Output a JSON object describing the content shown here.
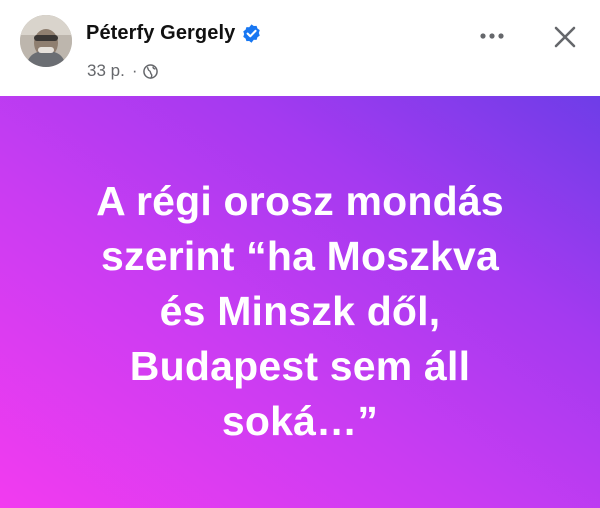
{
  "post": {
    "author": "Péterfy Gergely",
    "time": "33 p.",
    "separator": "·",
    "icons": {
      "verified": "verified-badge-icon",
      "audience": "globe-icon",
      "more": "more-options-icon",
      "close": "close-icon"
    },
    "colors": {
      "verified": "#1877f2",
      "banner_start": "#f23bf0",
      "banner_end": "#6e3de8"
    },
    "text_lines": [
      "A régi orosz mondás",
      "szerint “ha Moszkva",
      "és Minszk dől,",
      "Budapest sem áll",
      "soká…”"
    ]
  }
}
